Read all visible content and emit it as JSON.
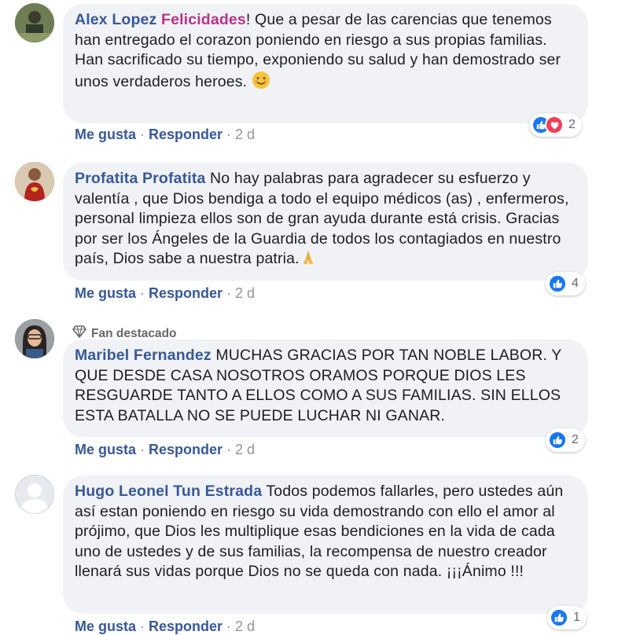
{
  "comments": [
    {
      "author": "Alex Lopez",
      "highlight": "Felicidades",
      "text": "! Que a pesar de las carencias que tenemos han entregado el corazon poniendo en riesgo a sus propias familias.\nHan sacrificado su tiempo, exponiendo su salud y han demostrado ser unos verdaderos heroes.",
      "like": "Me gusta",
      "reply": "Responder",
      "time": "2 d",
      "reactions": "2"
    },
    {
      "author": "Profatita Profatita",
      "text": " No hay palabras para agradecer su esfuerzo y valentía , que Dios bendiga a todo el equipo médicos (as) , enfermeros, personal limpieza ellos son de gran ayuda durante está crisis. Gracias por ser los Ángeles de la Guardia de todos los contagiados en nuestro país, Dios sabe a nuestra patria.",
      "like": "Me gusta",
      "reply": "Responder",
      "time": "2 d",
      "reactions": "4"
    },
    {
      "badge": "Fan destacado",
      "author": "Maribel Fernandez",
      "text": " MUCHAS GRACIAS POR TAN NOBLE LABOR. Y QUE DESDE CASA NOSOTROS ORAMOS PORQUE DIOS LES RESGUARDE TANTO A ELLOS COMO A SUS FAMILIAS. SIN ELLOS ESTA BATALLA NO SE PUEDE LUCHAR NI GANAR.",
      "like": "Me gusta",
      "reply": "Responder",
      "time": "2 d",
      "reactions": "2"
    },
    {
      "author": "Hugo Leonel Tun Estrada",
      "text": " Todos podemos fallarles, pero ustedes aún así estan poniendo en riesgo su vida demostrando con ello el amor al prójimo, que Dios les multiplique esas bendiciones en la vida de cada uno de ustedes y de sus familias, la recompensa de nuestro creador llenará sus vidas porque Dios no se queda con nada. ¡¡¡Ánimo !!!",
      "like": "Me gusta",
      "reply": "Responder",
      "time": "2 d",
      "reactions": "1"
    }
  ],
  "separator": "·",
  "icons": {
    "like": "thumbs-up-icon",
    "love": "heart-icon",
    "badge": "diamond-icon",
    "smile": "smiling-face-emoji",
    "pray": "folded-hands-emoji"
  },
  "colors": {
    "author": "#385898",
    "highlight": "#b5338a",
    "bubble": "#f0f2f5",
    "like": "#1877f2",
    "love": "#f33e58"
  }
}
